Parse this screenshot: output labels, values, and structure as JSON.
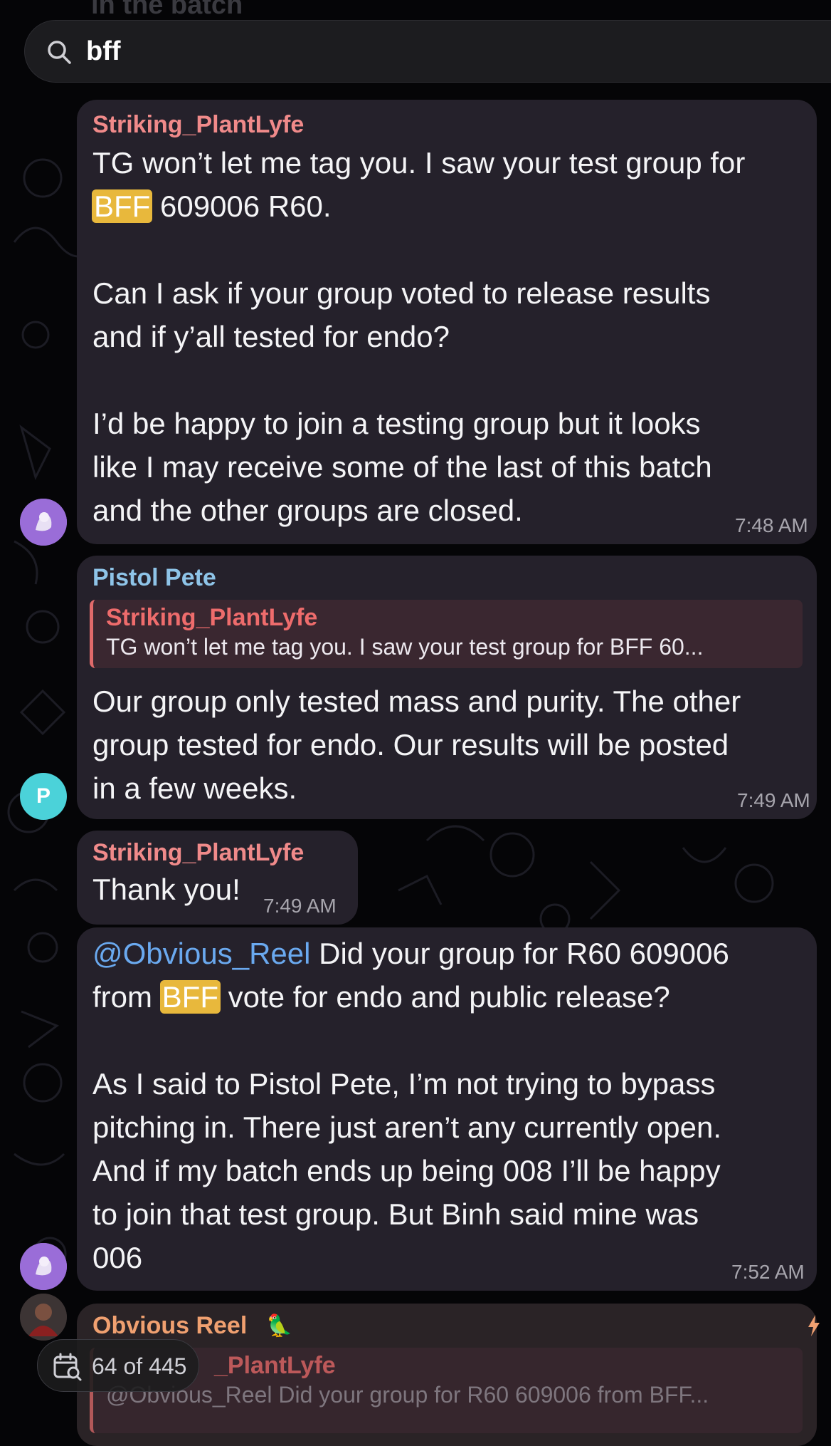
{
  "search": {
    "query": "bff"
  },
  "ghost_top_text": "in the batch",
  "messages": [
    {
      "sender": "Striking_PlantLyfe",
      "lines": [
        "TG won’t let me tag you. I saw your test group for",
        "609006 R60.",
        "",
        "Can I ask if your group voted to release results",
        "and if y’all tested for endo?",
        "",
        "I’d be happy to join a testing group but it looks",
        "like I may receive some of the last of this batch",
        "and the other groups are closed."
      ],
      "highlight": "BFF",
      "time": "7:48 AM"
    },
    {
      "sender": "Pistol Pete",
      "reply_sender": "Striking_PlantLyfe",
      "reply_text": "TG won’t let me tag you. I saw your test group for BFF 60...",
      "lines": [
        "Our group only tested mass and purity. The other",
        "group tested for endo. Our results will be posted",
        "in a few weeks."
      ],
      "time": "7:49 AM",
      "avatar_letter": "P"
    },
    {
      "sender": "Striking_PlantLyfe",
      "lines": [
        "Thank you!"
      ],
      "time": "7:49 AM"
    },
    {
      "mention": "@Obvious_Reel",
      "lines": [
        "Did your group for R60 609006",
        "from",
        "vote for endo and public release?",
        "",
        "As I said to Pistol Pete, I’m not trying to bypass",
        "pitching in. There just aren’t any currently open.",
        "And if my batch ends up being 008 I’ll be happy",
        "to join that test group. But Binh said mine was",
        "006"
      ],
      "highlight": "BFF",
      "time": "7:52 AM"
    },
    {
      "sender": "Obvious Reel",
      "reply_sender": "_PlantLyfe",
      "reply_text": "@Obvious_Reel Did your group for R60 609006 from BFF..."
    }
  ],
  "result_counter": "64 of 445",
  "colors": {
    "highlight": "#e8b83c",
    "mention": "#6aa9ef",
    "bubble": "#25212b"
  }
}
